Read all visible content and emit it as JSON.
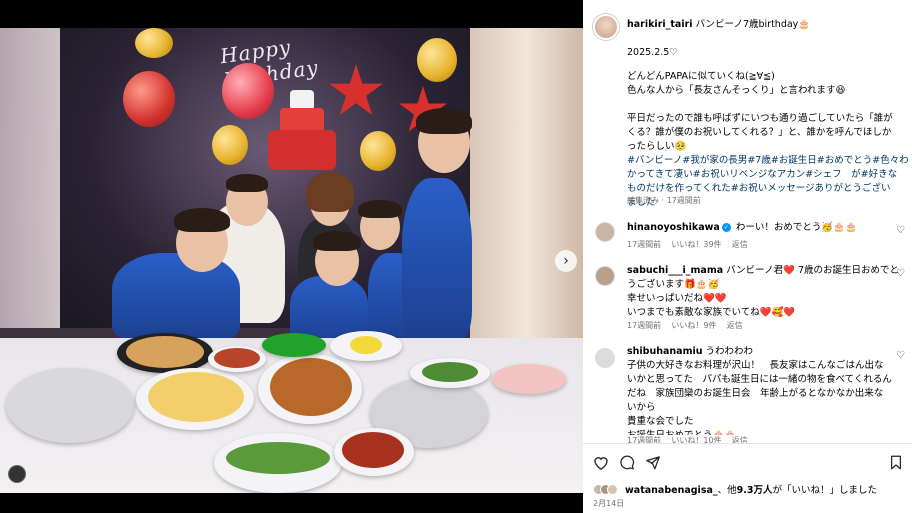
{
  "post": {
    "username": "harikiri_tairi",
    "title": "バンビーノ7歳birthday🎂",
    "date_line": "2025.2.5♡",
    "caption_lines": [
      "どんどんPAPAに似ていくね(≧∀≦)",
      "色んな人から「長友さんそっくり」と言われます😆",
      "",
      "平日だったので誰も呼ばずにいつも通り過ごしていたら「誰が",
      "くる？誰が僕のお祝いしてくれる？」と、誰かを呼んでほしか",
      "ったらしい🥺"
    ],
    "hashtag_lines": [
      "#バンビーノ#我が家の長男#7歳#お誕生日#おめでとう#色々わ",
      "かってきて凄い#お祝いリベンジなアカン#シェフ　が#好きな",
      "ものだけを作ってくれた#お祝いメッセージありがとうござい",
      "ました"
    ],
    "edited_label": "編集済み · 17週間前",
    "image_banner": "Happy Birthday"
  },
  "comments": [
    {
      "username": "hinanoyoshikawa",
      "verified": true,
      "lines": [
        "わーい！おめでとう🥳🎂🎂"
      ],
      "time": "17週間前",
      "likes": "いいね！39件",
      "reply": "返信"
    },
    {
      "username": "sabuchi___i_mama",
      "verified": false,
      "lines": [
        "バンビーノ君❤️ 7歳のお誕生日おめでと",
        "うございます🎁🎂🥳",
        "幸せいっぱいだね❤️❤️",
        "いつまでも素敵な家族でいてね❤️🥰❤️"
      ],
      "time": "17週間前",
      "likes": "いいね！9件",
      "reply": "返信"
    },
    {
      "username": "shibuhanamiu",
      "verified": false,
      "lines": [
        "うわわわわ",
        "子供の大好きなお料理が沢山！　長友家はこんなごはん出な",
        "いかと思ってた　パパも誕生日には一緒の物を食べてくれるん",
        "だね　家族団欒のお誕生日会　年齢上がるとなかなか出来な",
        "いから",
        "貴重な会でした",
        "お誕生日おめでとう🎂🎂"
      ],
      "time": "17週間前",
      "likes": "いいね！10件",
      "reply": "返信"
    }
  ],
  "actions": {
    "like_icon": "heart-outline-icon",
    "comment_icon": "comment-icon",
    "share_icon": "send-icon",
    "save_icon": "bookmark-icon"
  },
  "likes_summary": {
    "liker": "watanabenagisa_",
    "text_mid": "、他",
    "count": "9.3万人",
    "text_end": "が「いいね！」しました"
  },
  "post_date": "2月14日",
  "colors": {
    "link": "#00376b",
    "verified": "#0095f6",
    "muted": "#737373"
  }
}
